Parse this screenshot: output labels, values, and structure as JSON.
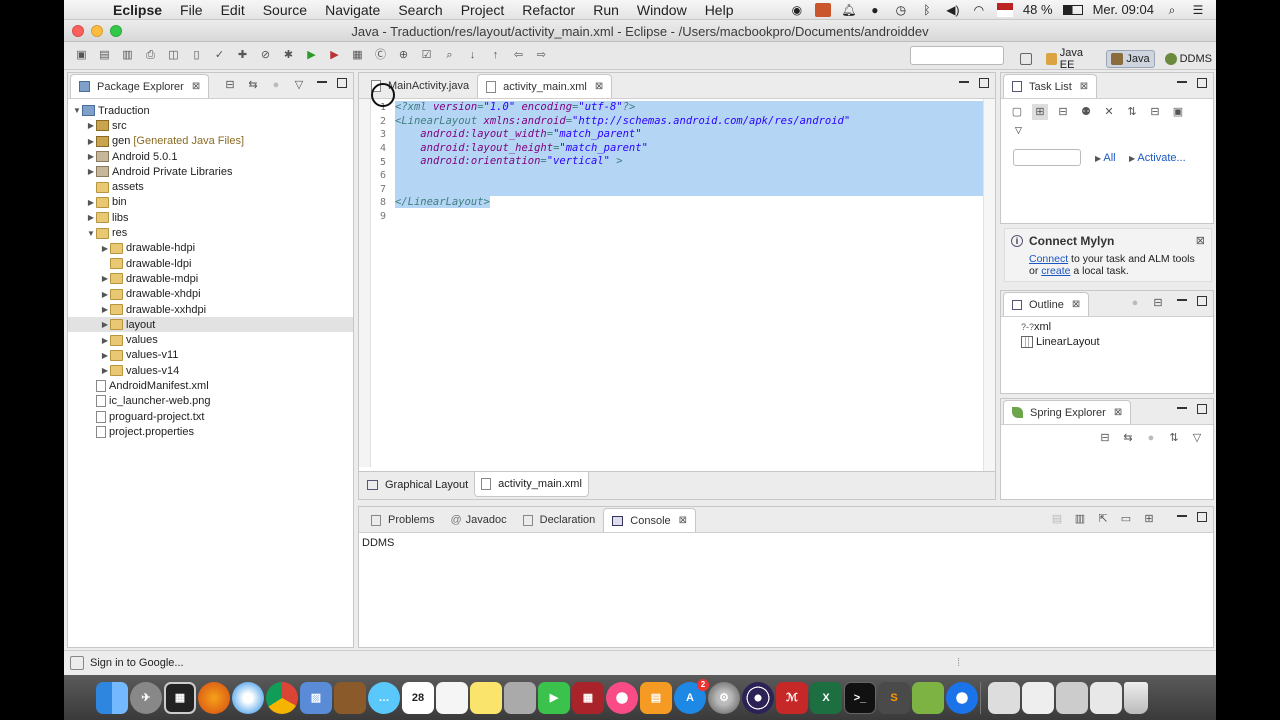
{
  "menubar": {
    "app": "Eclipse",
    "items": [
      "File",
      "Edit",
      "Source",
      "Navigate",
      "Search",
      "Project",
      "Refactor",
      "Run",
      "Window",
      "Help"
    ],
    "battery": "48 %",
    "clock": "Mer. 09:04"
  },
  "window": {
    "title": "Java - Traduction/res/layout/activity_main.xml - Eclipse - /Users/macbookpro/Documents/androiddev"
  },
  "perspectives": {
    "java_ee": "Java EE",
    "java": "Java",
    "ddms": "DDMS"
  },
  "package_explorer": {
    "title": "Package Explorer",
    "tree": [
      {
        "label": "Traduction",
        "indent": 0,
        "arrow": "▼",
        "icon": "project"
      },
      {
        "label": "src",
        "indent": 1,
        "arrow": "▶",
        "icon": "pkg"
      },
      {
        "label": "gen",
        "indent": 1,
        "arrow": "▶",
        "icon": "pkg",
        "deco": "[Generated Java Files]"
      },
      {
        "label": "Android 5.0.1",
        "indent": 1,
        "arrow": "▶",
        "icon": "lib"
      },
      {
        "label": "Android Private Libraries",
        "indent": 1,
        "arrow": "▶",
        "icon": "lib"
      },
      {
        "label": "assets",
        "indent": 1,
        "arrow": "",
        "icon": "folder"
      },
      {
        "label": "bin",
        "indent": 1,
        "arrow": "▶",
        "icon": "folder"
      },
      {
        "label": "libs",
        "indent": 1,
        "arrow": "▶",
        "icon": "folder"
      },
      {
        "label": "res",
        "indent": 1,
        "arrow": "▼",
        "icon": "folder"
      },
      {
        "label": "drawable-hdpi",
        "indent": 2,
        "arrow": "▶",
        "icon": "folder"
      },
      {
        "label": "drawable-ldpi",
        "indent": 2,
        "arrow": "",
        "icon": "folder"
      },
      {
        "label": "drawable-mdpi",
        "indent": 2,
        "arrow": "▶",
        "icon": "folder"
      },
      {
        "label": "drawable-xhdpi",
        "indent": 2,
        "arrow": "▶",
        "icon": "folder"
      },
      {
        "label": "drawable-xxhdpi",
        "indent": 2,
        "arrow": "▶",
        "icon": "folder"
      },
      {
        "label": "layout",
        "indent": 2,
        "arrow": "▶",
        "icon": "folder",
        "selected": true
      },
      {
        "label": "values",
        "indent": 2,
        "arrow": "▶",
        "icon": "folder"
      },
      {
        "label": "values-v11",
        "indent": 2,
        "arrow": "▶",
        "icon": "folder"
      },
      {
        "label": "values-v14",
        "indent": 2,
        "arrow": "▶",
        "icon": "folder"
      },
      {
        "label": "AndroidManifest.xml",
        "indent": 1,
        "arrow": "",
        "icon": "file"
      },
      {
        "label": "ic_launcher-web.png",
        "indent": 1,
        "arrow": "",
        "icon": "file"
      },
      {
        "label": "proguard-project.txt",
        "indent": 1,
        "arrow": "",
        "icon": "file"
      },
      {
        "label": "project.properties",
        "indent": 1,
        "arrow": "",
        "icon": "file"
      }
    ]
  },
  "editor": {
    "tabs": [
      {
        "label": "MainActivity.java",
        "selected": false
      },
      {
        "label": "activity_main.xml",
        "selected": true
      }
    ],
    "lines": [
      {
        "n": "1",
        "parts": [
          [
            "t",
            "<?xml "
          ],
          [
            "a",
            "version"
          ],
          [
            "t",
            "="
          ],
          [
            "v",
            "\"1.0\""
          ],
          [
            "t",
            " "
          ],
          [
            "a",
            "encoding"
          ],
          [
            "t",
            "="
          ],
          [
            "v",
            "\"utf-8\""
          ],
          [
            "t",
            "?>"
          ]
        ],
        "hl": true
      },
      {
        "n": "2",
        "parts": [
          [
            "t",
            "<LinearLayout "
          ],
          [
            "a",
            "xmlns:android"
          ],
          [
            "t",
            "="
          ],
          [
            "v",
            "\"http://schemas.android.com/apk/res/android\""
          ]
        ],
        "hl": true
      },
      {
        "n": "3",
        "parts": [
          [
            "t",
            "    "
          ],
          [
            "a",
            "android:layout_width"
          ],
          [
            "t",
            "="
          ],
          [
            "v",
            "\"match_parent\""
          ]
        ],
        "hl": true
      },
      {
        "n": "4",
        "parts": [
          [
            "t",
            "    "
          ],
          [
            "a",
            "android:layout_height"
          ],
          [
            "t",
            "="
          ],
          [
            "v",
            "\"match_parent\""
          ]
        ],
        "hl": true
      },
      {
        "n": "5",
        "parts": [
          [
            "t",
            "    "
          ],
          [
            "a",
            "android:orientation"
          ],
          [
            "t",
            "="
          ],
          [
            "v",
            "\"vertical\""
          ],
          [
            "t",
            " >"
          ]
        ],
        "hl": true
      },
      {
        "n": "6",
        "parts": [
          [
            "t",
            ""
          ]
        ],
        "hl": true
      },
      {
        "n": "7",
        "parts": [
          [
            "t",
            ""
          ]
        ],
        "hl": true
      },
      {
        "n": "8",
        "parts": [
          [
            "t",
            "</LinearLayout>"
          ]
        ],
        "hl": "partial"
      },
      {
        "n": "9",
        "parts": [
          [
            "t",
            ""
          ]
        ],
        "hl": false
      }
    ],
    "bottom_tabs": [
      "Graphical Layout",
      "activity_main.xml"
    ]
  },
  "task_list": {
    "title": "Task List",
    "filter_all": "All",
    "activate": "Activate..."
  },
  "mylyn": {
    "title": "Connect Mylyn",
    "connect": "Connect",
    "text1": " to your task and ALM tools",
    "or": "or ",
    "create": "create",
    "text2": " a local task."
  },
  "outline": {
    "title": "Outline",
    "items": [
      "xml",
      "LinearLayout"
    ],
    "xml_prefix": "?-?"
  },
  "spring": {
    "title": "Spring Explorer"
  },
  "console": {
    "tabs": [
      "Problems",
      "Javadoc",
      "Declaration",
      "Console"
    ],
    "content": "DDMS"
  },
  "status": {
    "text": "Sign in to Google..."
  },
  "dock": {
    "calendar_day": "28",
    "badge": "2"
  }
}
